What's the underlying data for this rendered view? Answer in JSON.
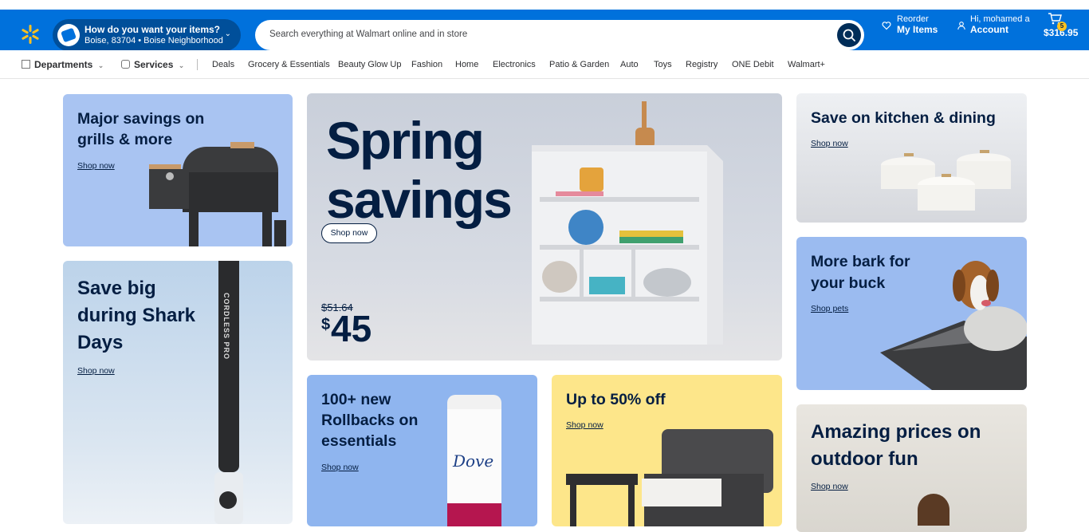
{
  "header": {
    "delivery_question": "How do you want your items?",
    "delivery_location": "Boise, 83704 • Boise Neighborhood ...",
    "search_placeholder": "Search everything at Walmart online and in store",
    "reorder_top": "Reorder",
    "reorder_bottom": "My Items",
    "account_top": "Hi, mohamed a",
    "account_bottom": "Account",
    "cart_count": "5",
    "cart_total": "$316.95",
    "icons": [
      "spark-logo-icon",
      "delivery-icon",
      "chevron-down-icon",
      "search-icon",
      "heart-icon",
      "user-icon",
      "cart-icon"
    ]
  },
  "nav": {
    "departments": "Departments",
    "services": "Services",
    "links": [
      "Deals",
      "Grocery & Essentials",
      "Beauty Glow Up",
      "Fashion",
      "Home",
      "Electronics",
      "Patio & Garden",
      "Auto",
      "Toys",
      "Registry",
      "ONE Debit",
      "Walmart+"
    ]
  },
  "tiles": {
    "grills": {
      "heading": "Major savings on grills & more",
      "link": "Shop now"
    },
    "shark": {
      "heading": "Save big during Shark Days",
      "link": "Shop now",
      "product_text": "CORDLESS PRO"
    },
    "spring": {
      "heading": "Spring savings",
      "button": "Shop now",
      "old_price": "$51.64",
      "price_symbol": "$",
      "price": "45"
    },
    "rollbacks": {
      "heading": "100+ new Rollbacks on essentials",
      "link": "Shop now",
      "brand": "Dove"
    },
    "outdoor_furniture": {
      "heading": "Up to 50% off",
      "link": "Shop now"
    },
    "kitchen": {
      "heading": "Save on kitchen & dining",
      "link": "Shop now"
    },
    "pets": {
      "heading": "More bark for your buck",
      "link": "Shop pets"
    },
    "outdoor": {
      "heading": "Amazing prices on outdoor fun",
      "link": "Shop now"
    }
  },
  "colors": {
    "brand_blue": "#0071dc",
    "brand_yellow": "#ffc220",
    "navy": "#041e42"
  }
}
